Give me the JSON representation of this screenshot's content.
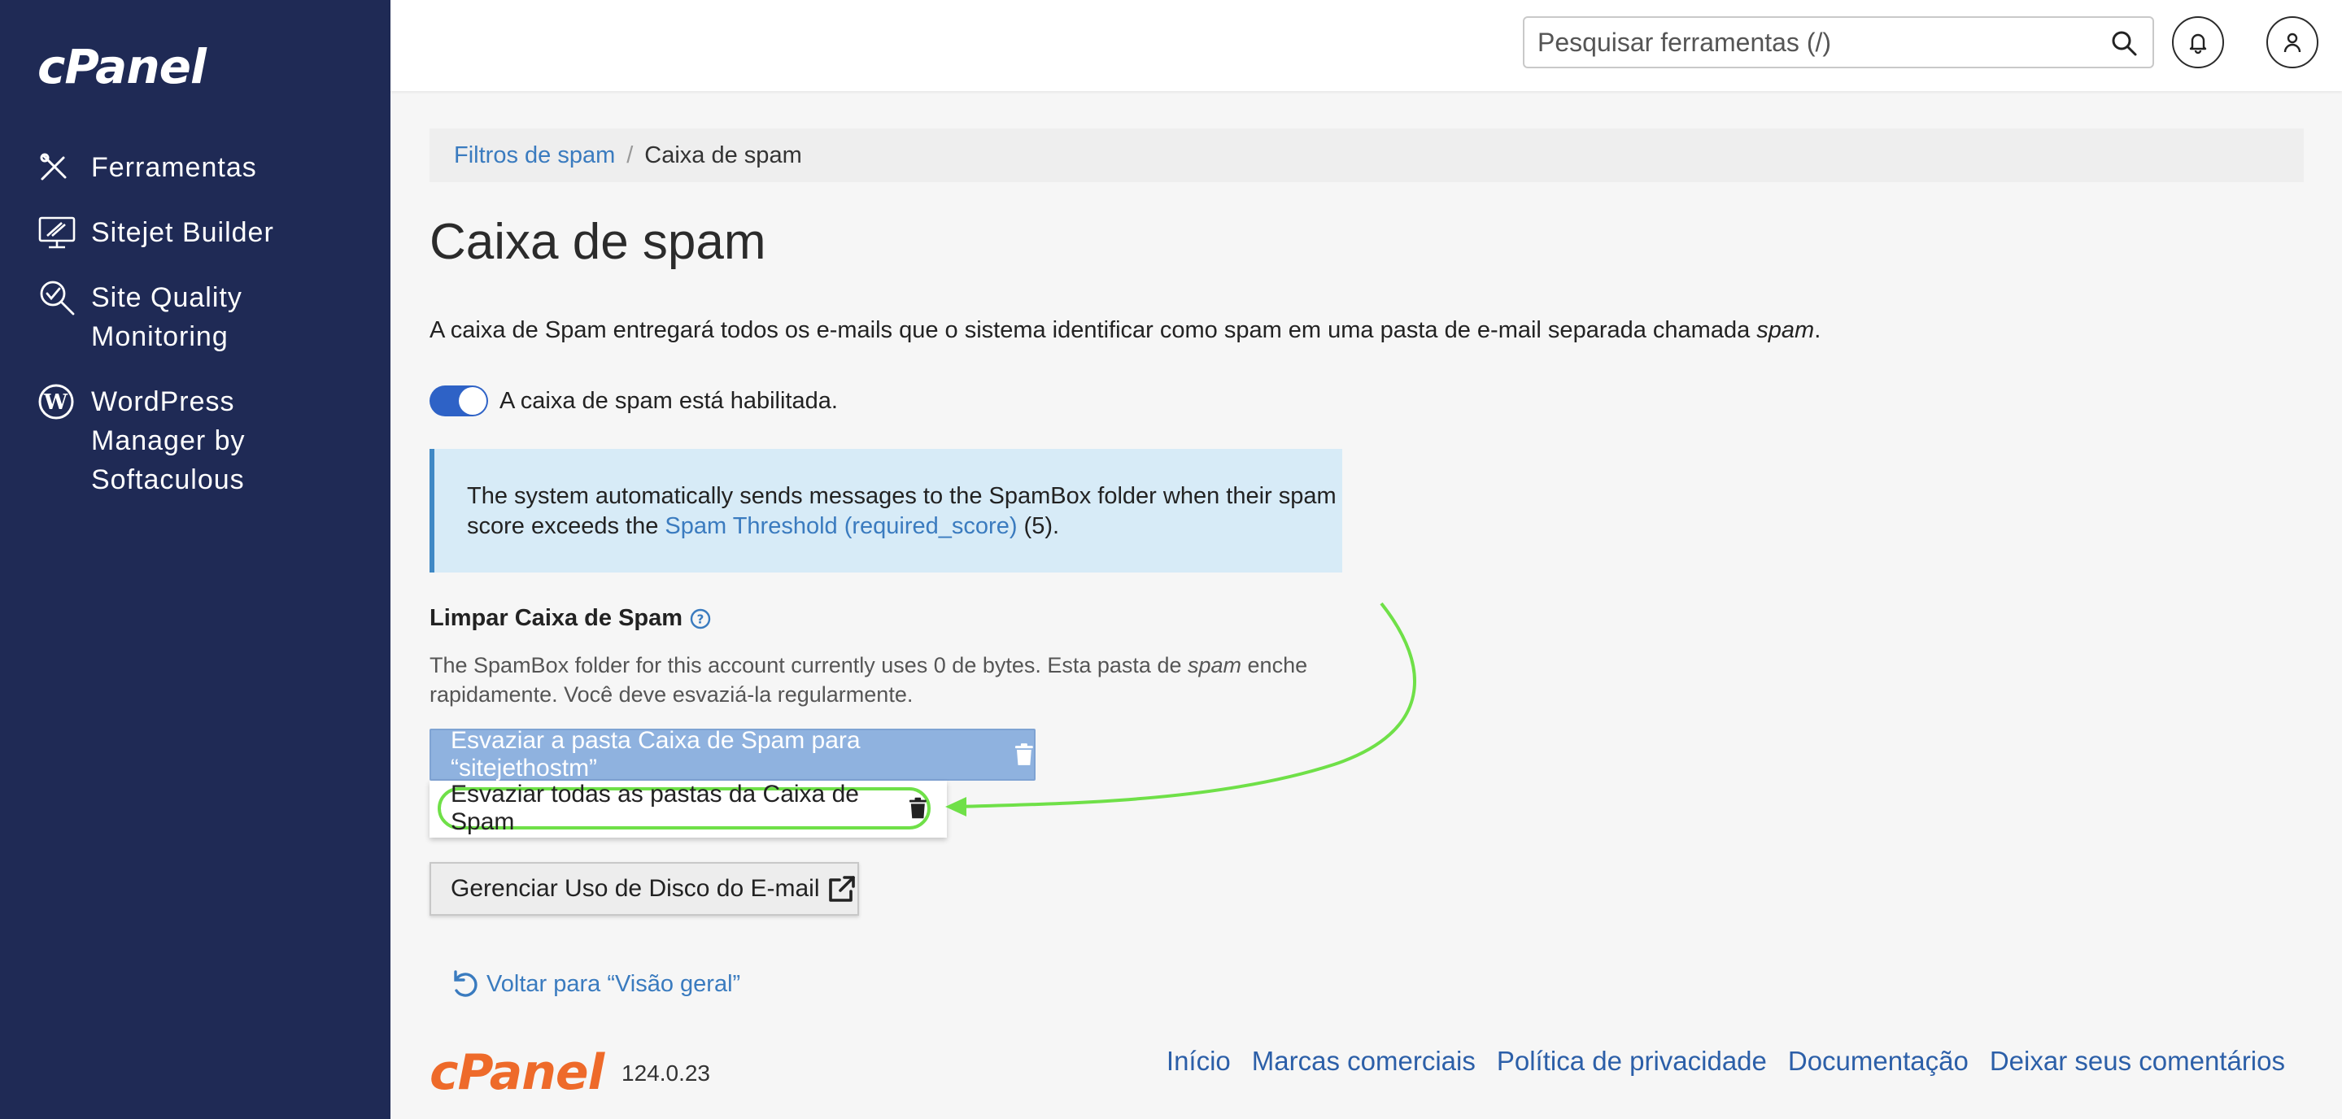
{
  "sidebar": {
    "brand": "cPanel",
    "items": [
      {
        "label": "Ferramentas",
        "icon": "tools-icon"
      },
      {
        "label": "Sitejet Builder",
        "icon": "sitejet-icon"
      },
      {
        "label": "Site Quality Monitoring",
        "icon": "site-quality-icon"
      },
      {
        "label": "WordPress Manager by Softaculous",
        "icon": "wordpress-icon"
      }
    ]
  },
  "header": {
    "search_placeholder": "Pesquisar ferramentas (/)"
  },
  "breadcrumb": {
    "parent": "Filtros de spam",
    "separator": "/",
    "current": "Caixa de spam"
  },
  "main": {
    "title": "Caixa de spam",
    "description_prefix": "A caixa de Spam entregará todos os e-mails que o sistema identificar como spam em uma pasta de e-mail separada chamada ",
    "description_em": "spam",
    "description_suffix": ".",
    "toggle_label": "A caixa de spam está habilitada.",
    "toggle_on": true,
    "info_prefix": "The system automatically sends messages to the SpamBox folder when their spam score exceeds the ",
    "info_link": "Spam Threshold (required_score)",
    "info_suffix": " (5).",
    "section_title": "Limpar Caixa de Spam",
    "section_desc_prefix": "The SpamBox folder for this account currently uses 0 de bytes. Esta pasta de ",
    "section_desc_em": "spam",
    "section_desc_suffix": " enche rapidamente. Você deve esvaziá-la regularmente.",
    "empty_button": "Esvaziar a pasta Caixa de Spam para “sitejethostm”",
    "empty_all_option": "Esvaziar todas as pastas da Caixa de Spam",
    "manage_disk_button": "Gerenciar Uso de Disco do E-mail",
    "back_link": "Voltar para “Visão geral”"
  },
  "footer": {
    "logo": "cPanel",
    "version": "124.0.23",
    "links": [
      "Início",
      "Marcas comerciais",
      "Política de privacidade",
      "Documentação",
      "Deixar seus comentários"
    ]
  },
  "colors": {
    "sidebar": "#1f2a55",
    "accent": "#2e62c6",
    "link": "#3a7bbf",
    "highlight": "#6fe048",
    "logo_orange": "#ee6a2a"
  }
}
